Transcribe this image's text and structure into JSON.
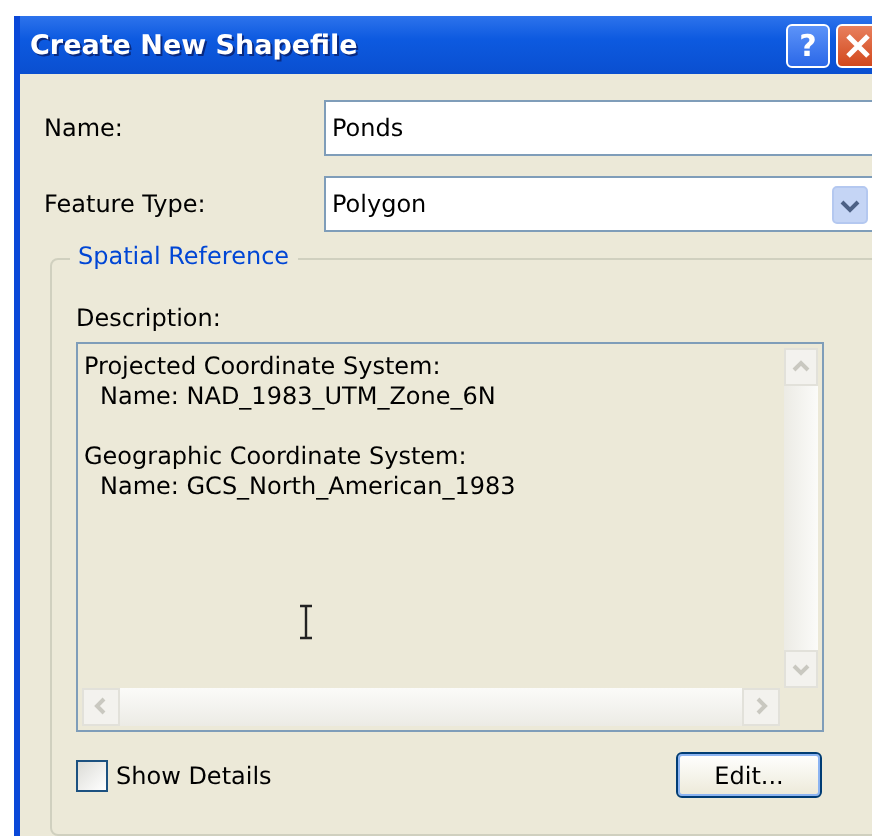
{
  "window": {
    "title": "Create New Shapefile",
    "help_button": "?"
  },
  "name_field": {
    "label": "Name:",
    "value": "Ponds"
  },
  "feature_type": {
    "label": "Feature Type:",
    "value": "Polygon"
  },
  "spatial_reference": {
    "legend": "Spatial Reference",
    "description_label": "Description:",
    "description_sections": [
      {
        "heading": "Projected Coordinate System:",
        "name_line": "Name: NAD_1983_UTM_Zone_6N"
      },
      {
        "heading": "Geographic Coordinate System:",
        "name_line": "Name: GCS_North_American_1983"
      }
    ]
  },
  "show_details": {
    "label": "Show Details",
    "checked": false
  },
  "edit_button": "Edit..."
}
